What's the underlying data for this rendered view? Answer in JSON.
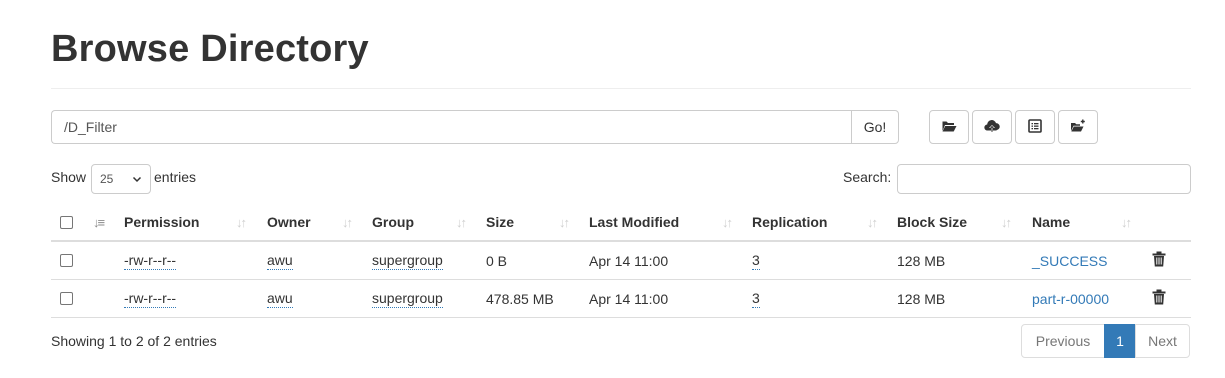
{
  "page": {
    "title": "Browse Directory"
  },
  "path_bar": {
    "value": "/D_Filter",
    "go_label": "Go!"
  },
  "toolbar": {
    "icons": [
      "folder-open-icon",
      "cloud-upload-icon",
      "list-icon",
      "create-folder-icon"
    ]
  },
  "controls": {
    "show_label": "Show",
    "page_size": "25",
    "entries_label": "entries",
    "search_label": "Search:",
    "search_value": ""
  },
  "table": {
    "columns": [
      "Permission",
      "Owner",
      "Group",
      "Size",
      "Last Modified",
      "Replication",
      "Block Size",
      "Name"
    ],
    "rows": [
      {
        "permission": "-rw-r--r--",
        "owner": "awu",
        "group": "supergroup",
        "size": "0 B",
        "last_modified": "Apr 14 11:00",
        "replication": "3",
        "block_size": "128 MB",
        "name": "_SUCCESS"
      },
      {
        "permission": "-rw-r--r--",
        "owner": "awu",
        "group": "supergroup",
        "size": "478.85 MB",
        "last_modified": "Apr 14 11:00",
        "replication": "3",
        "block_size": "128 MB",
        "name": "part-r-00000"
      }
    ]
  },
  "footer": {
    "info": "Showing 1 to 2 of 2 entries",
    "previous_label": "Previous",
    "current_page": "1",
    "next_label": "Next"
  },
  "colors": {
    "link": "#337ab7",
    "active_page": "#337ab7",
    "border": "#cccccc"
  }
}
